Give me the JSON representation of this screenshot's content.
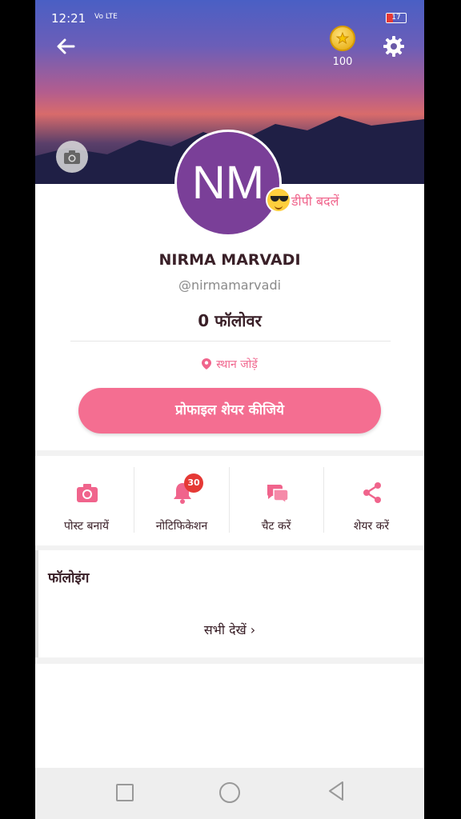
{
  "status_bar": {
    "time": "12:21",
    "network": "Vo LTE",
    "battery": "17"
  },
  "header": {
    "coins": "100"
  },
  "profile": {
    "initials": "NM",
    "change_dp": "डीपी बदलें",
    "name": "NIRMA MARVADI",
    "handle": "@nirmamarvadi",
    "followers": "0 फॉलोवर",
    "location": "स्थान जोड़ें",
    "share_button": "प्रोफाइल शेयर कीजिये"
  },
  "actions": [
    {
      "label": "पोस्ट बनायें",
      "icon": "camera-icon"
    },
    {
      "label": "नोटिफिकेशन",
      "icon": "bell-icon",
      "badge": "30"
    },
    {
      "label": "चैट करें",
      "icon": "chat-icon"
    },
    {
      "label": "शेयर करें",
      "icon": "share-icon"
    }
  ],
  "following": {
    "title": "फॉलोइंग",
    "see_all": "सभी देखें  ›"
  },
  "colors": {
    "accent": "#f46e91",
    "avatar": "#7a3f98",
    "badge": "#e53935"
  }
}
